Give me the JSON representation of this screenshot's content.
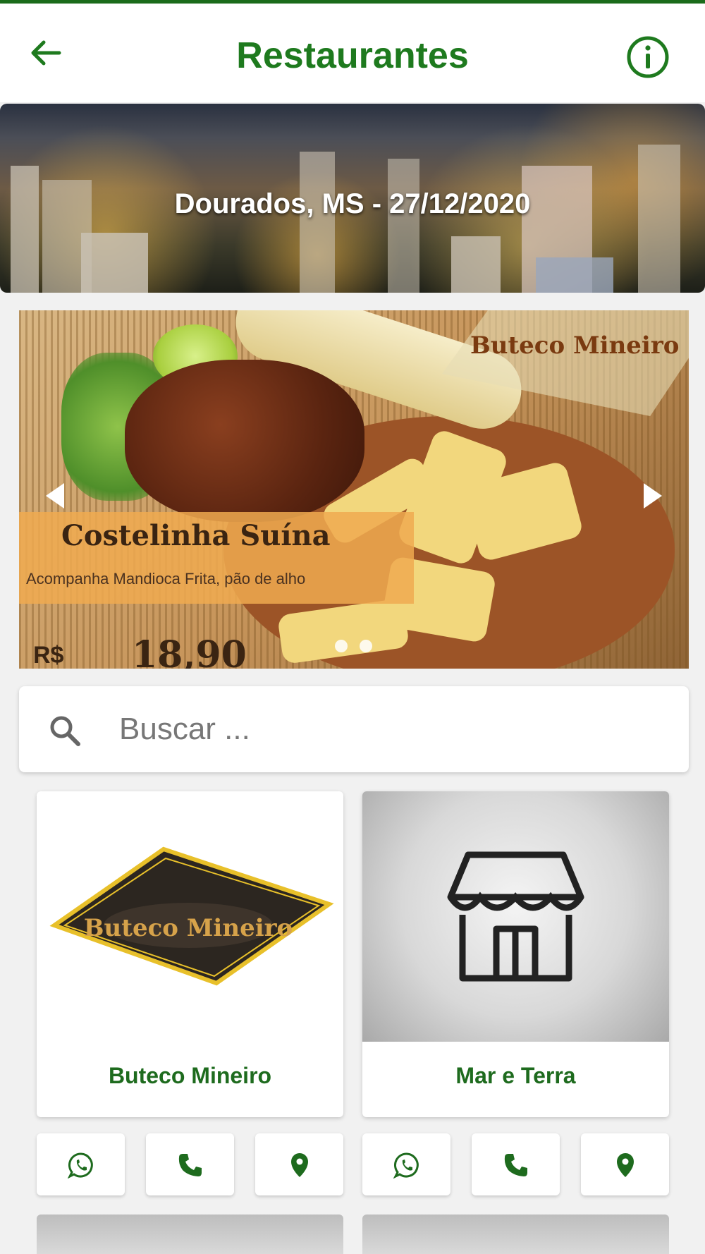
{
  "header": {
    "title": "Restaurantes",
    "back_icon": "arrow-left-icon",
    "info_icon": "info-circle-icon"
  },
  "banner": {
    "caption": "Dourados, MS - 27/12/2020"
  },
  "carousel": {
    "slide": {
      "brand": "Buteco Mineiro",
      "dish_name": "Costelinha Suína",
      "description": "Acompanha Mandioca Frita, pão de alho",
      "currency": "R$",
      "price": "18,90"
    },
    "dots": 2
  },
  "search": {
    "placeholder": "Buscar ..."
  },
  "restaurants": [
    {
      "name": "Buteco Mineiro",
      "logo_text": "Buteco Mineiro"
    },
    {
      "name": "Mar e Terra",
      "image_icon": "storefront-icon"
    }
  ],
  "actions": [
    "whatsapp-icon",
    "phone-icon",
    "location-pin-icon"
  ],
  "colors": {
    "brand_green": "#1e7a1e",
    "top_line": "#1b6b1b",
    "background": "#f1f1f1"
  }
}
